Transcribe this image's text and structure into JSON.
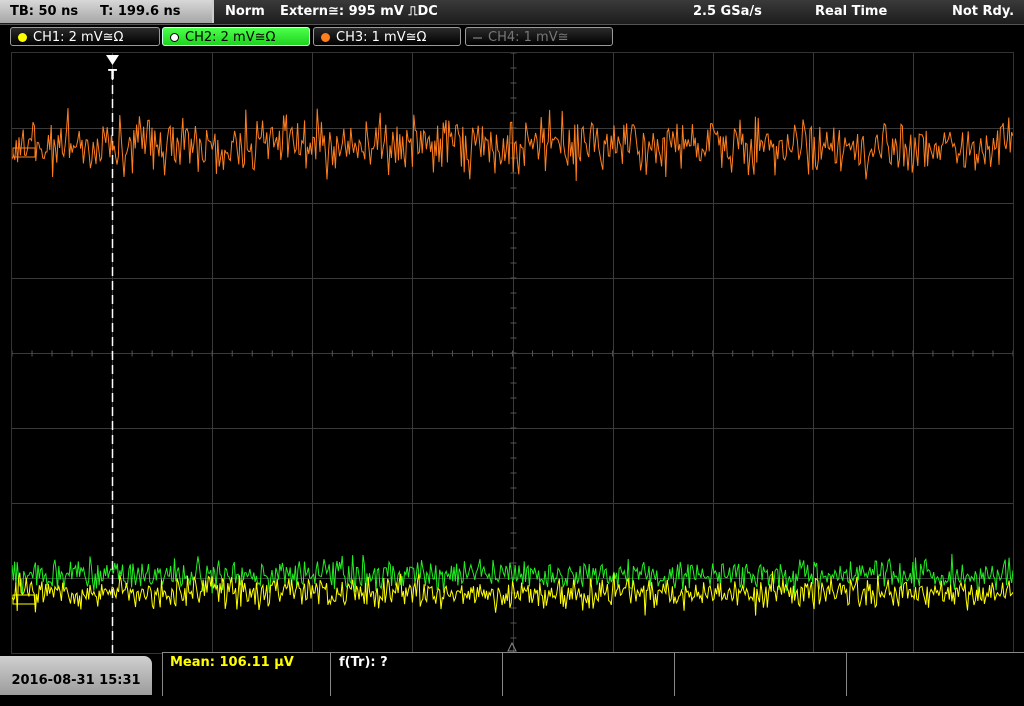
{
  "status": {
    "timebase": "TB: 50 ns",
    "trigger_time": "T: 199.6 ns",
    "mode": "Norm",
    "trigger_source": "Extern≅: 995 mV ⎍DC",
    "sample_rate": "2.5 GSa/s",
    "acq_mode": "Real Time",
    "state": "Not Rdy."
  },
  "channels": [
    {
      "label": "CH1: 2 mV≅Ω",
      "color": "#ffff00",
      "state": "on"
    },
    {
      "label": "CH2: 2 mV≅Ω",
      "color": "#2ee62e",
      "state": "selected"
    },
    {
      "label": "CH3: 1 mV≅Ω",
      "color": "#ff7f1f",
      "state": "on"
    },
    {
      "label": "CH4: 1 mV≅",
      "color": "#666666",
      "state": "off"
    }
  ],
  "trigger_marker": "T",
  "footer": {
    "datetime": "2016-08-31 15:31",
    "mean": "Mean: 106.11 µV",
    "ftr": "f(Tr): ?"
  },
  "colors": {
    "ch1": "#ffff00",
    "ch2": "#22ee22",
    "ch3": "#ff7f1f",
    "grid": "#3a3a3a"
  }
}
